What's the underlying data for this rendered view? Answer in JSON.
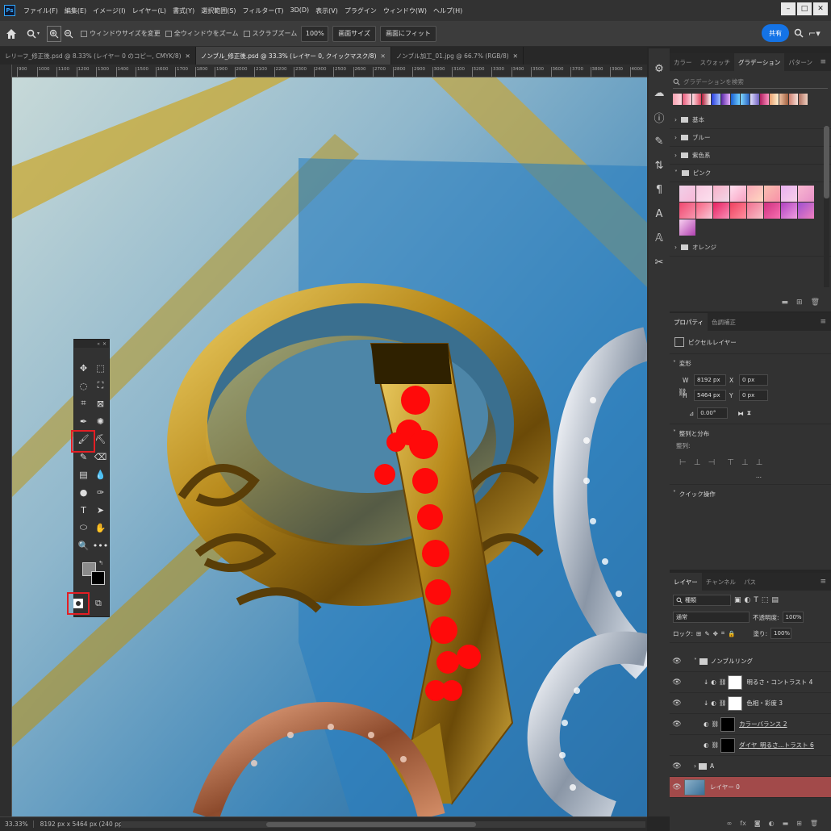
{
  "app": {
    "logo": "Ps",
    "menu": [
      "ファイル(F)",
      "編集(E)",
      "イメージ(I)",
      "レイヤー(L)",
      "書式(Y)",
      "選択範囲(S)",
      "フィルター(T)",
      "3D(D)",
      "表示(V)",
      "プラグイン",
      "ウィンドウ(W)",
      "ヘルプ(H)"
    ]
  },
  "options": {
    "home_icon": "home-icon",
    "zoom_icon": "zoom-icon",
    "checkboxes": [
      "ウィンドウサイズを変更",
      "全ウィンドウをズーム",
      "スクラブズーム"
    ],
    "zoom_value": "100%",
    "btn_fit_screen": "画面サイズ",
    "btn_fill_screen": "画面にフィット",
    "share": "共有"
  },
  "tabs": [
    {
      "label": "レリーフ_修正後.psd @ 8.33% (レイヤー 0 のコピー, CMYK/8)",
      "active": false
    },
    {
      "label": "ノンブル_修正後.psd @ 33.3% (レイヤー 0, クイックマスク/8)",
      "active": true
    },
    {
      "label": "ノンブル加工_01.jpg @ 66.7% (RGB/8)",
      "active": false
    }
  ],
  "ruler_ticks": [
    "900",
    "1000",
    "1100",
    "1200",
    "1300",
    "1400",
    "1500",
    "1600",
    "1700",
    "1800",
    "1900",
    "2000",
    "2100",
    "2200",
    "2300",
    "2400",
    "2500",
    "2600",
    "2700",
    "2800",
    "2900",
    "3000",
    "3100",
    "3200",
    "3300",
    "3400",
    "3500",
    "3600",
    "3700",
    "3800",
    "3900",
    "4000"
  ],
  "status": {
    "zoom": "33.33%",
    "doc_info": "8192 px x 5464 px (240 ppi)"
  },
  "gradients": {
    "tabs": [
      "カラー",
      "スウォッチ",
      "グラデーション",
      "パターン"
    ],
    "active_tab": 2,
    "search_placeholder": "グラデーションを検索",
    "folders": [
      {
        "label": "基本",
        "open": false
      },
      {
        "label": "ブルー",
        "open": false
      },
      {
        "label": "紫色系",
        "open": false
      },
      {
        "label": "ピンク",
        "open": true
      },
      {
        "label": "オレンジ",
        "open": false
      }
    ]
  },
  "properties": {
    "tabs": [
      "プロパティ",
      "色調補正"
    ],
    "layer_kind": "ピクセルレイヤー",
    "transform_title": "変形",
    "w": "8192 px",
    "h": "5464 px",
    "x": "0 px",
    "y": "0 px",
    "angle": "0.00°",
    "align_title": "整列と分布",
    "align_label": "整列:",
    "more": "...",
    "quick_title": "クイック操作"
  },
  "layers": {
    "tabs": [
      "レイヤー",
      "チャンネル",
      "パス"
    ],
    "filter_kind": "種類",
    "blend_mode": "通常",
    "opacity_label": "不透明度:",
    "opacity": "100%",
    "lock_label": "ロック:",
    "fill_label": "塗り:",
    "fill": "100%",
    "items": [
      {
        "name": "ノンブルリング",
        "type": "group",
        "visible": true,
        "indent": 1
      },
      {
        "name": "明るさ・コントラスト 4",
        "type": "adjust",
        "visible": true,
        "indent": 2
      },
      {
        "name": "色相・彩度 3",
        "type": "adjust",
        "visible": true,
        "indent": 2
      },
      {
        "name": "カラーバランス 2",
        "type": "masked",
        "visible": true,
        "indent": 2
      },
      {
        "name": "ダイヤ_明るさ...トラスト 6",
        "type": "masked",
        "visible": false,
        "indent": 2
      },
      {
        "name": "A",
        "type": "group",
        "visible": true,
        "indent": 1
      },
      {
        "name": "レイヤー 0",
        "type": "pixel",
        "visible": true,
        "indent": 0,
        "selected": true
      }
    ]
  },
  "colors": {
    "accent": "#1473e6",
    "highlight_box": "#e31e24",
    "selected_layer": "#a24a4a",
    "mask_red": "#ff0a0a"
  }
}
